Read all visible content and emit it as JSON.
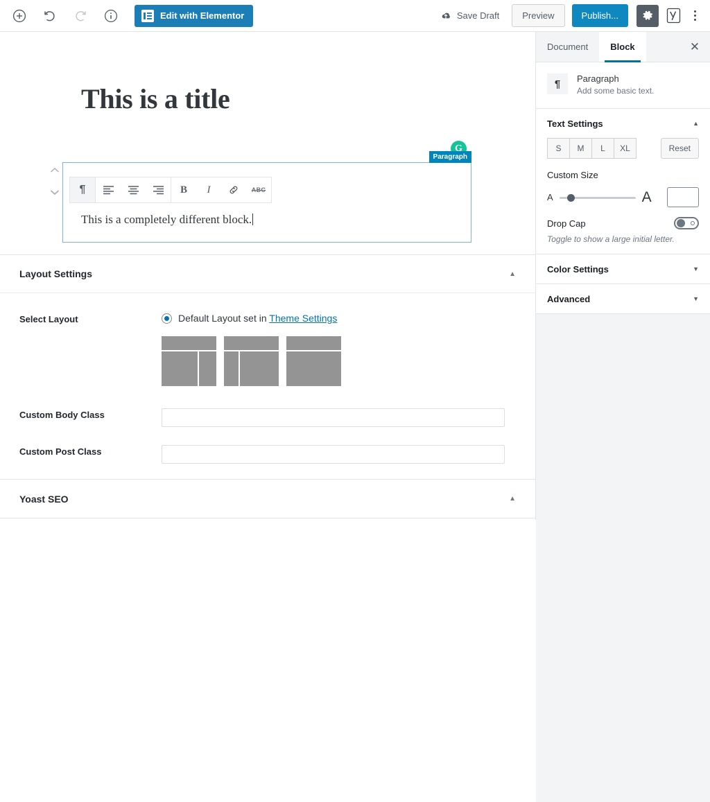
{
  "topbar": {
    "add_block_icon": "plus-circle-icon",
    "undo_icon": "undo-icon",
    "redo_icon": "redo-icon",
    "info_icon": "info-circle-icon",
    "elementor_label": "Edit with Elementor",
    "elementor_icon": "elementor-logo-icon",
    "save_draft_label": "Save Draft",
    "save_draft_icon": "cloud-upload-icon",
    "preview_label": "Preview",
    "publish_label": "Publish...",
    "gear_icon": "gear-icon",
    "yoast_icon": "yoast-seo-icon",
    "kebab_icon": "more-options-icon",
    "accent_blue": "#0f88c0",
    "elementor_blue": "#1c7eb6"
  },
  "canvas": {
    "post_title": "This is a title",
    "grammarly_icon": "grammarly-icon",
    "grammarly_letter": "G",
    "block_label": "Paragraph",
    "block_text": "This is a completely different block.",
    "mover_up_icon": "chevron-up-icon",
    "mover_down_icon": "chevron-down-icon",
    "block_border_color": "#7eb4d4",
    "block_label_bg": "#0085ba"
  },
  "block_toolbar": {
    "buttons": [
      {
        "name": "block-type-paragraph",
        "icon": "pilcrow-icon",
        "glyph": "¶",
        "active": true
      },
      {
        "name": "align-left",
        "icon": "align-left-icon",
        "glyph": "",
        "active": false
      },
      {
        "name": "align-center",
        "icon": "align-center-icon",
        "glyph": "",
        "active": false
      },
      {
        "name": "align-right",
        "icon": "align-right-icon",
        "glyph": "",
        "active": false
      },
      {
        "name": "bold",
        "icon": "bold-icon",
        "glyph": "B",
        "active": false
      },
      {
        "name": "italic",
        "icon": "italic-icon",
        "glyph": "I",
        "active": false
      },
      {
        "name": "link",
        "icon": "link-icon",
        "glyph": "",
        "active": false
      },
      {
        "name": "strikethrough",
        "icon": "strikethrough-icon",
        "glyph": "ABC",
        "active": false
      }
    ]
  },
  "layout_settings": {
    "panel_title": "Layout Settings",
    "toggle_icon": "caret-up-icon",
    "select_layout_label": "Select Layout",
    "radio_text_prefix": "Default Layout set in ",
    "radio_link_text": "Theme Settings",
    "radio_selected": true,
    "layouts": [
      {
        "name": "layout-right-sidebar",
        "type": "right-sidebar"
      },
      {
        "name": "layout-left-sidebar",
        "type": "left-sidebar"
      },
      {
        "name": "layout-full-width",
        "type": "full-width"
      }
    ],
    "custom_body_class_label": "Custom Body Class",
    "custom_body_class_value": "",
    "custom_post_class_label": "Custom Post Class",
    "custom_post_class_value": ""
  },
  "yoast_panel": {
    "panel_title": "Yoast SEO",
    "toggle_icon": "caret-up-icon"
  },
  "sidebar": {
    "tabs": [
      {
        "label": "Document",
        "active": false
      },
      {
        "label": "Block",
        "active": true
      }
    ],
    "close_icon": "close-icon",
    "close_glyph": "✕",
    "block_card": {
      "icon": "pilcrow-icon",
      "icon_glyph": "¶",
      "name": "Paragraph",
      "description": "Add some basic text."
    },
    "text_settings": {
      "title": "Text Settings",
      "toggle_icon": "caret-up-icon",
      "size_buttons": [
        "S",
        "M",
        "L",
        "XL"
      ],
      "reset_label": "Reset",
      "custom_size_label": "Custom Size",
      "small_a": "A",
      "large_a": "A",
      "slider_value_percent": 12,
      "size_input_value": "",
      "drop_cap_label": "Drop Cap",
      "drop_cap_enabled": false,
      "drop_cap_help": "Toggle to show a large initial letter."
    },
    "collapsed_panels": [
      {
        "title": "Color Settings",
        "toggle_icon": "caret-down-icon"
      },
      {
        "title": "Advanced",
        "toggle_icon": "caret-down-icon"
      }
    ]
  }
}
